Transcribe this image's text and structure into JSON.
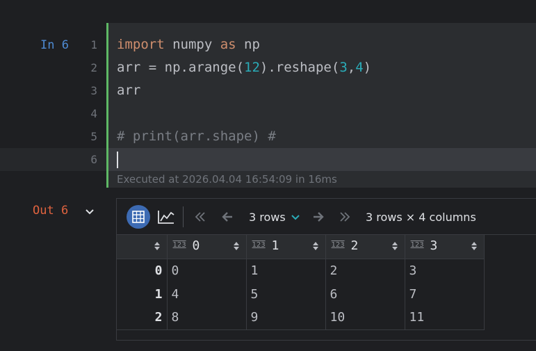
{
  "input_cell": {
    "label": "In 6",
    "line_numbers": [
      "1",
      "2",
      "3",
      "4",
      "5",
      "6"
    ],
    "code": {
      "l1_kw1": "import",
      "l1_t1": " numpy ",
      "l1_kw2": "as",
      "l1_t2": " np",
      "l2_t1": "arr = np.arange(",
      "l2_n1": "12",
      "l2_t2": ").reshape(",
      "l2_n2": "3",
      "l2_t3": ",",
      "l2_n3": "4",
      "l2_t4": ")",
      "l3": "arr",
      "l4": "",
      "l5": "# print(arr.shape) #",
      "l6": ""
    },
    "executed": "Executed at 2026.04.04 16:54:09 in 16ms"
  },
  "output_cell": {
    "label": "Out 6",
    "toolbar": {
      "rows_selector": "3 rows",
      "shape": "3 rows × 4 columns"
    },
    "table": {
      "type_badge": "123",
      "columns": [
        "0",
        "1",
        "2",
        "3"
      ],
      "rows": [
        {
          "index": "0",
          "cells": [
            "0",
            "1",
            "2",
            "3"
          ]
        },
        {
          "index": "1",
          "cells": [
            "4",
            "5",
            "6",
            "7"
          ]
        },
        {
          "index": "2",
          "cells": [
            "8",
            "9",
            "10",
            "11"
          ]
        }
      ]
    }
  },
  "colors": {
    "accent": "#3d6bb3",
    "gutter_marker": "#5fb865",
    "out_label": "#e0633f",
    "in_label": "#4e8bd4"
  }
}
